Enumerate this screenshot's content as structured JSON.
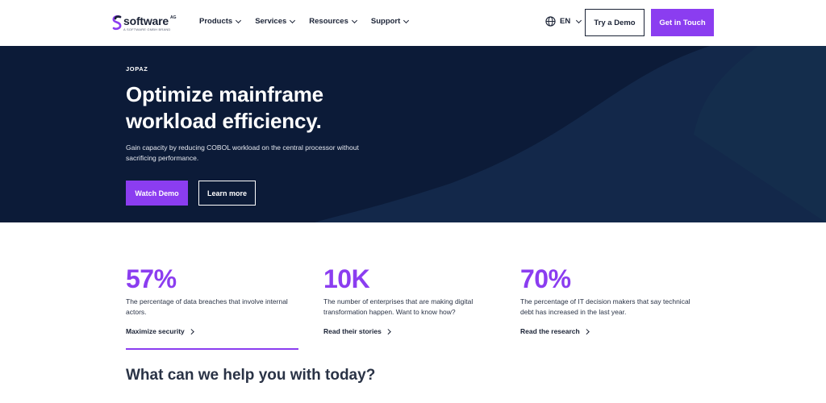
{
  "header": {
    "logo": {
      "word": "software",
      "superscript": "AG",
      "tagline": "A SOFTWARE GMBH BRAND"
    },
    "nav": [
      {
        "label": "Products"
      },
      {
        "label": "Services"
      },
      {
        "label": "Resources"
      },
      {
        "label": "Support"
      }
    ],
    "language": "EN",
    "try_demo_label": "Try a Demo",
    "get_in_touch_label": "Get in Touch"
  },
  "hero": {
    "eyebrow": "JOPAZ",
    "title": "Optimize mainframe workload efficiency.",
    "subtitle": "Gain capacity by reducing COBOL workload on the central processor without sacrificing performance.",
    "watch_demo_label": "Watch Demo",
    "learn_more_label": "Learn more"
  },
  "stats": [
    {
      "value": "57%",
      "description": "The percentage of data breaches that involve internal actors.",
      "link": "Maximize security"
    },
    {
      "value": "10K",
      "description": "The number of enterprises that are making digital transformation happen. Want to know how?",
      "link": "Read their stories"
    },
    {
      "value": "70%",
      "description": "The percentage of IT decision makers that say technical debt has increased in the last year.",
      "link": "Read the research"
    }
  ],
  "help_heading": "What can we help you with today?",
  "colors": {
    "accent": "#8b3df0",
    "navy": "#0d1d3a",
    "text": "#1b2336"
  },
  "icons": {
    "globe": "globe-icon",
    "chevron": "chevron-down-icon",
    "arrow": "chevron-right-icon"
  }
}
